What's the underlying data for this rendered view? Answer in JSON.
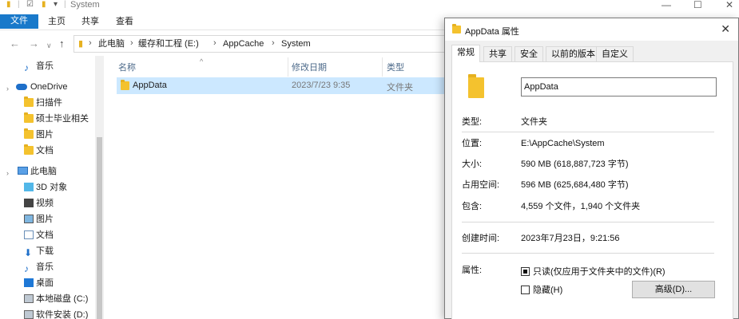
{
  "explorer": {
    "window_title": "System",
    "window_controls": {
      "minimize": "—",
      "maximize": "☐",
      "close": "✕"
    },
    "ribbon_tabs": [
      "文件",
      "主页",
      "共享",
      "查看"
    ],
    "breadcrumb": [
      "此电脑",
      "缓存和工程 (E:)",
      "AppCache",
      "System"
    ],
    "nav_items": [
      {
        "label": "音乐",
        "icon": "music-icon"
      },
      {
        "label": "OneDrive",
        "icon": "cloud-icon"
      },
      {
        "label": "扫描件",
        "icon": "folder-icon"
      },
      {
        "label": "硕士毕业相关",
        "icon": "folder-icon"
      },
      {
        "label": "图片",
        "icon": "folder-icon"
      },
      {
        "label": "文档",
        "icon": "folder-icon"
      },
      {
        "label": "此电脑",
        "icon": "computer-icon"
      },
      {
        "label": "3D 对象",
        "icon": "cube-icon"
      },
      {
        "label": "视频",
        "icon": "video-icon"
      },
      {
        "label": "图片",
        "icon": "picture-icon"
      },
      {
        "label": "文档",
        "icon": "document-icon"
      },
      {
        "label": "下载",
        "icon": "download-icon"
      },
      {
        "label": "音乐",
        "icon": "music-icon"
      },
      {
        "label": "桌面",
        "icon": "desktop-icon"
      },
      {
        "label": "本地磁盘 (C:)",
        "icon": "drive-icon"
      },
      {
        "label": "软件安装 (D:)",
        "icon": "drive-icon"
      }
    ],
    "columns": {
      "name": "名称",
      "modified": "修改日期",
      "type": "类型"
    },
    "files": [
      {
        "name": "AppData",
        "modified": "2023/7/23 9:35",
        "type": "文件夹"
      }
    ]
  },
  "dialog": {
    "title": "AppData 属性",
    "close": "✕",
    "tabs": [
      "常规",
      "共享",
      "安全",
      "以前的版本",
      "自定义"
    ],
    "folder_name": "AppData",
    "properties": {
      "type_label": "类型:",
      "type_value": "文件夹",
      "location_label": "位置:",
      "location_value": "E:\\AppCache\\System",
      "size_label": "大小:",
      "size_value": "590 MB (618,887,723 字节)",
      "disk_label": "占用空间:",
      "disk_value": "596 MB (625,684,480 字节)",
      "contains_label": "包含:",
      "contains_value": "4,559 个文件，1,940 个文件夹",
      "created_label": "创建时间:",
      "created_value": "2023年7月23日，9:21:56",
      "attributes_label": "属性:"
    },
    "attributes": {
      "readonly_label": "只读(仅应用于文件夹中的文件)(R)",
      "hidden_label": "隐藏(H)",
      "advanced_label": "高级(D)..."
    }
  }
}
